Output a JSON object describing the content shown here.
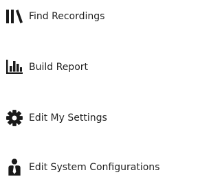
{
  "menu": {
    "icon_color": "#1a1a1a",
    "items": [
      {
        "label": "Find Recordings",
        "icon": "library-icon"
      },
      {
        "label": "Build Report",
        "icon": "bar-chart-icon"
      },
      {
        "label": "Edit My Settings",
        "icon": "gear-icon"
      },
      {
        "label": "Edit System Configurations",
        "icon": "user-tie-icon"
      }
    ]
  }
}
